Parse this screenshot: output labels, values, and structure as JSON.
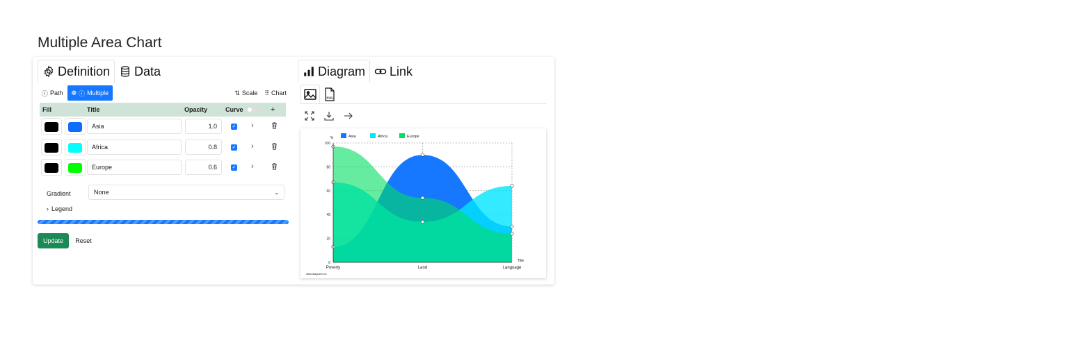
{
  "page": {
    "title": "Multiple Area Chart"
  },
  "left_tabs": [
    {
      "label": "Definition",
      "icon": "gear-icon",
      "active": true
    },
    {
      "label": "Data",
      "icon": "database-icon",
      "active": false
    }
  ],
  "mode_bar": {
    "path_label": "Path",
    "multiple_label": "Multiple",
    "scale_label": "Scale",
    "chart_label": "Chart"
  },
  "table": {
    "headers": {
      "fill": "Fill",
      "title": "Title",
      "opacity": "Opacity",
      "curve": "Curve"
    },
    "rows": [
      {
        "stroke_color": "#000000",
        "fill_color": "#0d6efd",
        "title": "Asia",
        "opacity": "1.0",
        "checked": true
      },
      {
        "stroke_color": "#000000",
        "fill_color": "#00ffff",
        "title": "Africa",
        "opacity": "0.8",
        "checked": true
      },
      {
        "stroke_color": "#000000",
        "fill_color": "#00ff00",
        "title": "Europe",
        "opacity": "0.6",
        "checked": true
      }
    ]
  },
  "gradient": {
    "label": "Gradient",
    "value": "None"
  },
  "legend_toggle": {
    "label": "Legend"
  },
  "buttons": {
    "update": "Update",
    "reset": "Reset"
  },
  "colors": {
    "primary": "#1677ff",
    "success": "#1b8a56",
    "table_header": "#cfe3d8"
  },
  "right_tabs": [
    {
      "label": "Diagram",
      "icon": "bar-chart-icon",
      "active": true
    },
    {
      "label": "Link",
      "icon": "link-icon",
      "active": false
    }
  ],
  "export_tabs": [
    {
      "icon": "image-icon",
      "active": true
    },
    {
      "icon": "svg-file-icon",
      "label": "SVG",
      "active": false
    }
  ],
  "tools": [
    "fullscreen-icon",
    "download-icon",
    "arrow-right-icon"
  ],
  "chart_data": {
    "type": "area",
    "categories": [
      "Poverty",
      "Land",
      "Language"
    ],
    "series": [
      {
        "name": "Asia",
        "values": [
          13,
          90,
          30
        ],
        "color": "#1677ff",
        "opacity": 1.0
      },
      {
        "name": "Africa",
        "values": [
          67,
          34,
          64
        ],
        "color": "#00e5ff",
        "opacity": 0.8
      },
      {
        "name": "Europe",
        "values": [
          97,
          54,
          24
        ],
        "color": "#00e060",
        "opacity": 0.6
      }
    ],
    "ylabel": "%",
    "xlabel": "Title",
    "ylim": [
      0,
      100
    ],
    "yticks": [
      0,
      20,
      40,
      60,
      80,
      100
    ],
    "legend_position": "top",
    "curve": true,
    "source": "data.diagrams.io"
  }
}
